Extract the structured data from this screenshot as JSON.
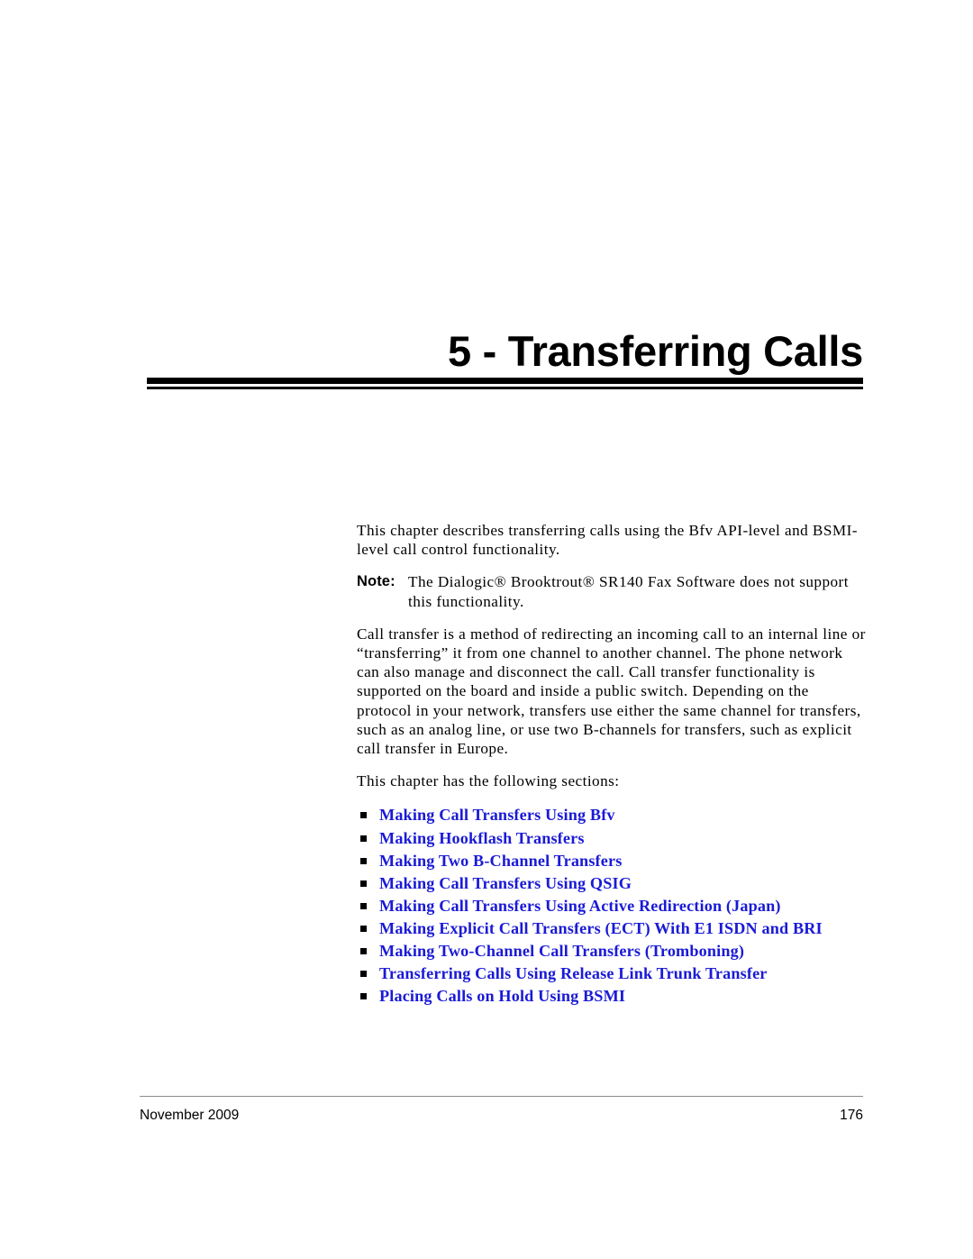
{
  "document": {
    "chapter_title": "5 - Transferring Calls"
  },
  "body": {
    "intro_paragraph": "This chapter describes transferring calls using the Bfv API-level and BSMI-level call control functionality.",
    "note": {
      "label": "Note:",
      "text": "The Dialogic® Brooktrout® SR140 Fax Software does not support this functionality."
    },
    "description_paragraph": "Call transfer is a method of redirecting an incoming call to an internal line or “transferring” it from one channel to another channel. The phone network can also manage and disconnect the call. Call transfer functionality is supported on the board and inside a public switch. Depending on the protocol in your network, transfers use either the same channel for transfers, such as an analog line, or use two B-channels for transfers, such as explicit call transfer in Europe.",
    "sections_lead_in": "This chapter has the following sections:"
  },
  "sections": {
    "bullet_icon": "black-square-bullet",
    "link_color": "#1a1ad6",
    "items": [
      {
        "label": "Making Call Transfers Using Bfv"
      },
      {
        "label": "Making Hookflash Transfers"
      },
      {
        "label": "Making Two B-Channel Transfers"
      },
      {
        "label": "Making Call Transfers Using QSIG"
      },
      {
        "label": "Making Call Transfers Using Active Redirection (Japan)"
      },
      {
        "label": "Making Explicit Call Transfers (ECT) With E1 ISDN and BRI"
      },
      {
        "label": "Making Two-Channel Call Transfers (Tromboning)"
      },
      {
        "label": "Transferring Calls Using Release Link Trunk Transfer"
      },
      {
        "label": "Placing Calls on Hold Using BSMI"
      }
    ]
  },
  "footer": {
    "date": "November 2009",
    "page_number": "176"
  }
}
